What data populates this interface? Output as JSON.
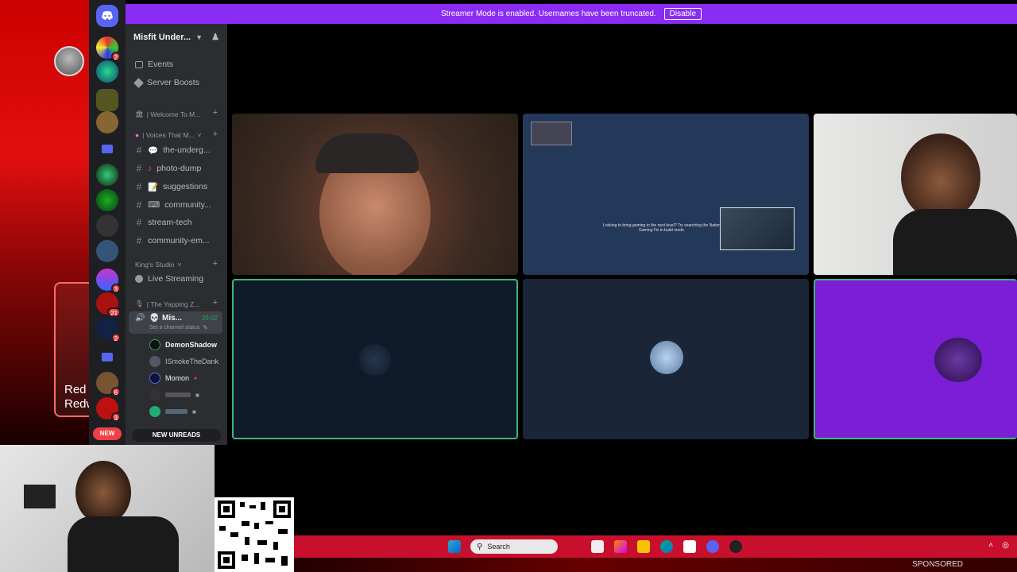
{
  "banner": {
    "text": "Streamer Mode is enabled. Usernames have been truncated.",
    "button": "Disable"
  },
  "server": {
    "name": "Misfit Under..."
  },
  "nav": {
    "events": "Events",
    "boosts": "Server Boosts"
  },
  "categories": {
    "welcome": "| Welcome To M...",
    "voices": "| Voices That M...",
    "kings": "King's Studio",
    "yapping": "| The Yapping Z..."
  },
  "channels": [
    "the-underg...",
    "photo-dump",
    "suggestions",
    "community...",
    "stream-tech",
    "community-em..."
  ],
  "live_streaming": "Live Streaming",
  "voice_channel": {
    "name": "Mis...",
    "timer": "29:02",
    "status": "Set a channel status",
    "users": [
      "DemonShadow",
      "ISmokeTheDank",
      "Momon"
    ]
  },
  "rail_badges": [
    "2",
    "3",
    "21",
    "2",
    "6",
    "3"
  ],
  "rail_new": "NEW",
  "new_unreads": "NEW UNREADS",
  "tile2_caption": "Looking to bring gaming to the next level? Try searching the Nation Gaming Fix in build mode.",
  "background_text": "Red\nRedw",
  "taskbar": {
    "search": "Search"
  },
  "sponsored": "SPONSORED",
  "colors": {
    "banner": "#8b2cf5",
    "speaking_border": "#3fb67a",
    "taskbar": "#c8102e",
    "rail": "#1e1f22",
    "sidebar": "#2b2d31"
  }
}
